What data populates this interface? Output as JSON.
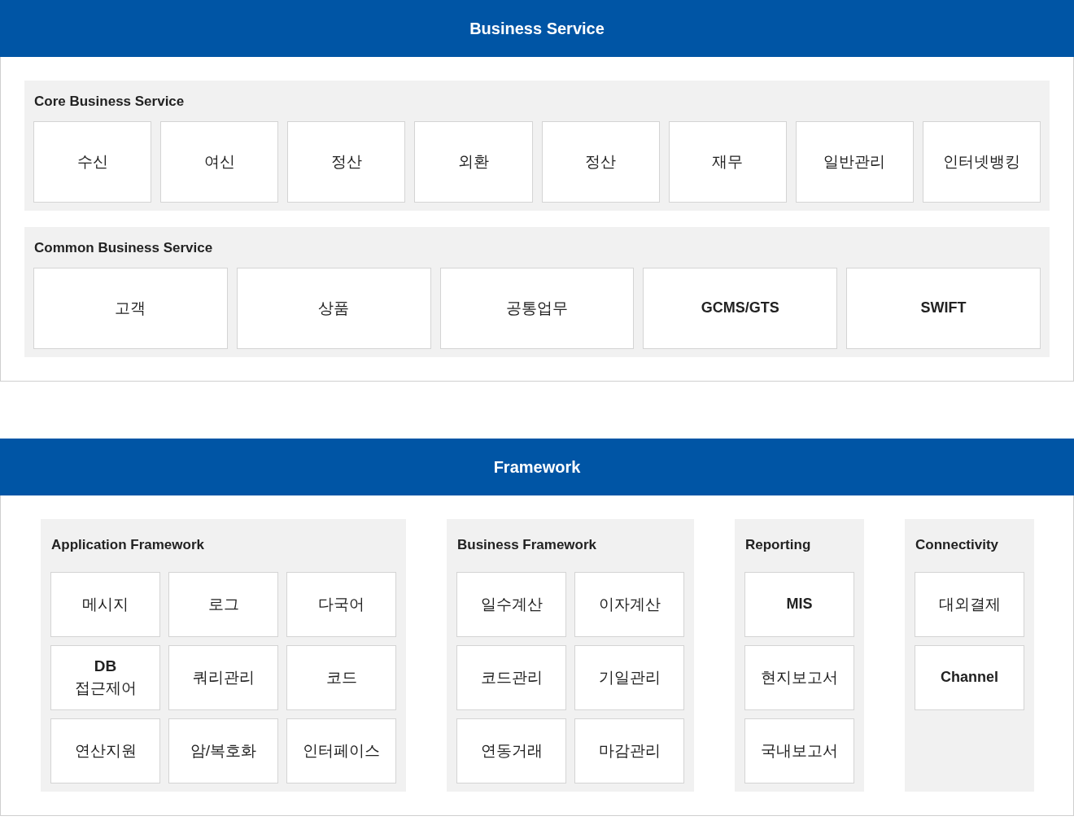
{
  "sections": [
    {
      "title": "Business Service",
      "kind": "rows",
      "groups": [
        {
          "title": "Core Business Service",
          "cards": [
            {
              "text": "수신",
              "bold": false
            },
            {
              "text": "여신",
              "bold": false
            },
            {
              "text": "정산",
              "bold": false
            },
            {
              "text": "외환",
              "bold": false
            },
            {
              "text": "정산",
              "bold": false
            },
            {
              "text": "재무",
              "bold": false
            },
            {
              "text": "일반관리",
              "bold": false
            },
            {
              "text": "인터넷뱅킹",
              "bold": false
            }
          ]
        },
        {
          "title": "Common Business Service",
          "cards": [
            {
              "text": "고객",
              "bold": false
            },
            {
              "text": "상품",
              "bold": false
            },
            {
              "text": "공통업무",
              "bold": false
            },
            {
              "text": "GCMS/GTS",
              "bold": true
            },
            {
              "text": "SWIFT",
              "bold": true
            }
          ]
        }
      ]
    },
    {
      "title": "Framework",
      "kind": "columns",
      "groups": [
        {
          "title": "Application Framework",
          "rows": [
            [
              {
                "text": "메시지",
                "bold": false
              },
              {
                "text": "로그",
                "bold": false
              },
              {
                "text": "다국어",
                "bold": false
              }
            ],
            [
              {
                "text": "**DB**\n접근제어",
                "bold": false
              },
              {
                "text": "쿼리관리",
                "bold": false
              },
              {
                "text": "코드",
                "bold": false
              }
            ],
            [
              {
                "text": "연산지원",
                "bold": false
              },
              {
                "text": "암/복호화",
                "bold": false
              },
              {
                "text": "인터페이스",
                "bold": false
              }
            ]
          ]
        },
        {
          "title": "Business Framework",
          "rows": [
            [
              {
                "text": "일수계산",
                "bold": false
              },
              {
                "text": "이자계산",
                "bold": false
              }
            ],
            [
              {
                "text": "코드관리",
                "bold": false
              },
              {
                "text": "기일관리",
                "bold": false
              }
            ],
            [
              {
                "text": "연동거래",
                "bold": false
              },
              {
                "text": "마감관리",
                "bold": false
              }
            ]
          ]
        },
        {
          "title": "Reporting",
          "rows": [
            [
              {
                "text": "MIS",
                "bold": true
              }
            ],
            [
              {
                "text": "현지보고서",
                "bold": false
              }
            ],
            [
              {
                "text": "국내보고서",
                "bold": false
              }
            ]
          ]
        },
        {
          "title": "Connectivity",
          "rows": [
            [
              {
                "text": "대외결제",
                "bold": false
              }
            ],
            [
              {
                "text": "Channel",
                "bold": true
              }
            ]
          ]
        }
      ]
    }
  ]
}
